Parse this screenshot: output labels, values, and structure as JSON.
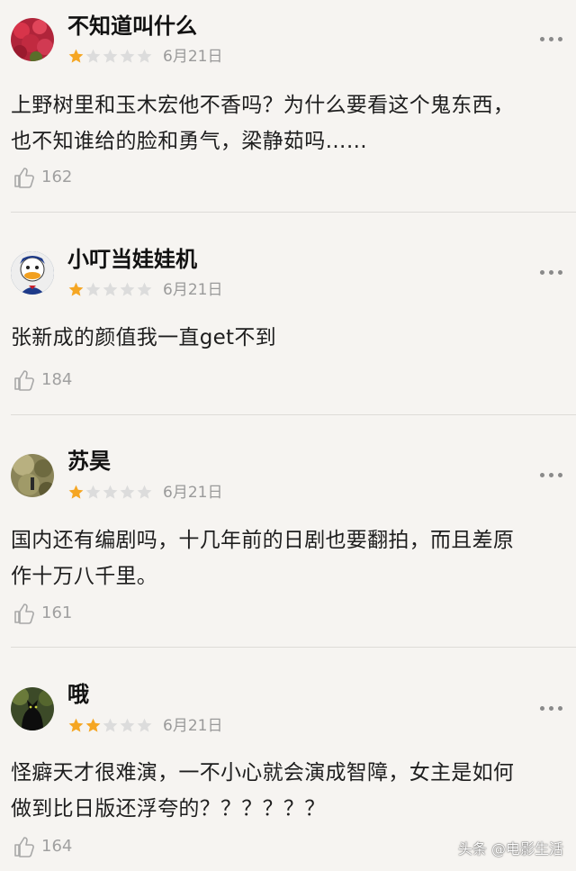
{
  "comments": [
    {
      "username": "不知道叫什么",
      "avatar": "red-flowers-avatar",
      "rating": 1,
      "date": "6月21日",
      "text_lines": [
        "上野树里和玉木宏他不香吗？为什么要看这个鬼东西，",
        "也不知谁给的脸和勇气，梁静茹吗……"
      ],
      "likes": "162"
    },
    {
      "username": "小叮当娃娃机",
      "avatar": "donald-duck-avatar",
      "rating": 1,
      "date": "6月21日",
      "text_lines": [
        "张新成的颜值我一直get不到"
      ],
      "likes": "184"
    },
    {
      "username": "苏昊",
      "avatar": "blurry-photo-avatar",
      "rating": 1,
      "date": "6月21日",
      "text_lines": [
        "国内还有编剧吗，十几年前的日剧也要翻拍，而且差原",
        "作十万八千里。"
      ],
      "likes": "161"
    },
    {
      "username": "哦",
      "avatar": "black-cat-avatar",
      "rating": 2,
      "date": "6月21日",
      "text_lines": [
        "怪癖天才很难演，一不小心就会演成智障，女主是如何",
        "做到比日版还浮夸的？？？？？？"
      ],
      "likes": "164"
    }
  ],
  "watermark": "头条 @电影生活",
  "colors": {
    "background": "#f6f4f1",
    "star_filled": "#f5a623",
    "star_empty": "#dcdcdc",
    "muted_text": "#9a9a9a"
  },
  "icons": {
    "like": "thumbs-up-icon",
    "more": "more-dots-icon",
    "star": "star-icon"
  }
}
